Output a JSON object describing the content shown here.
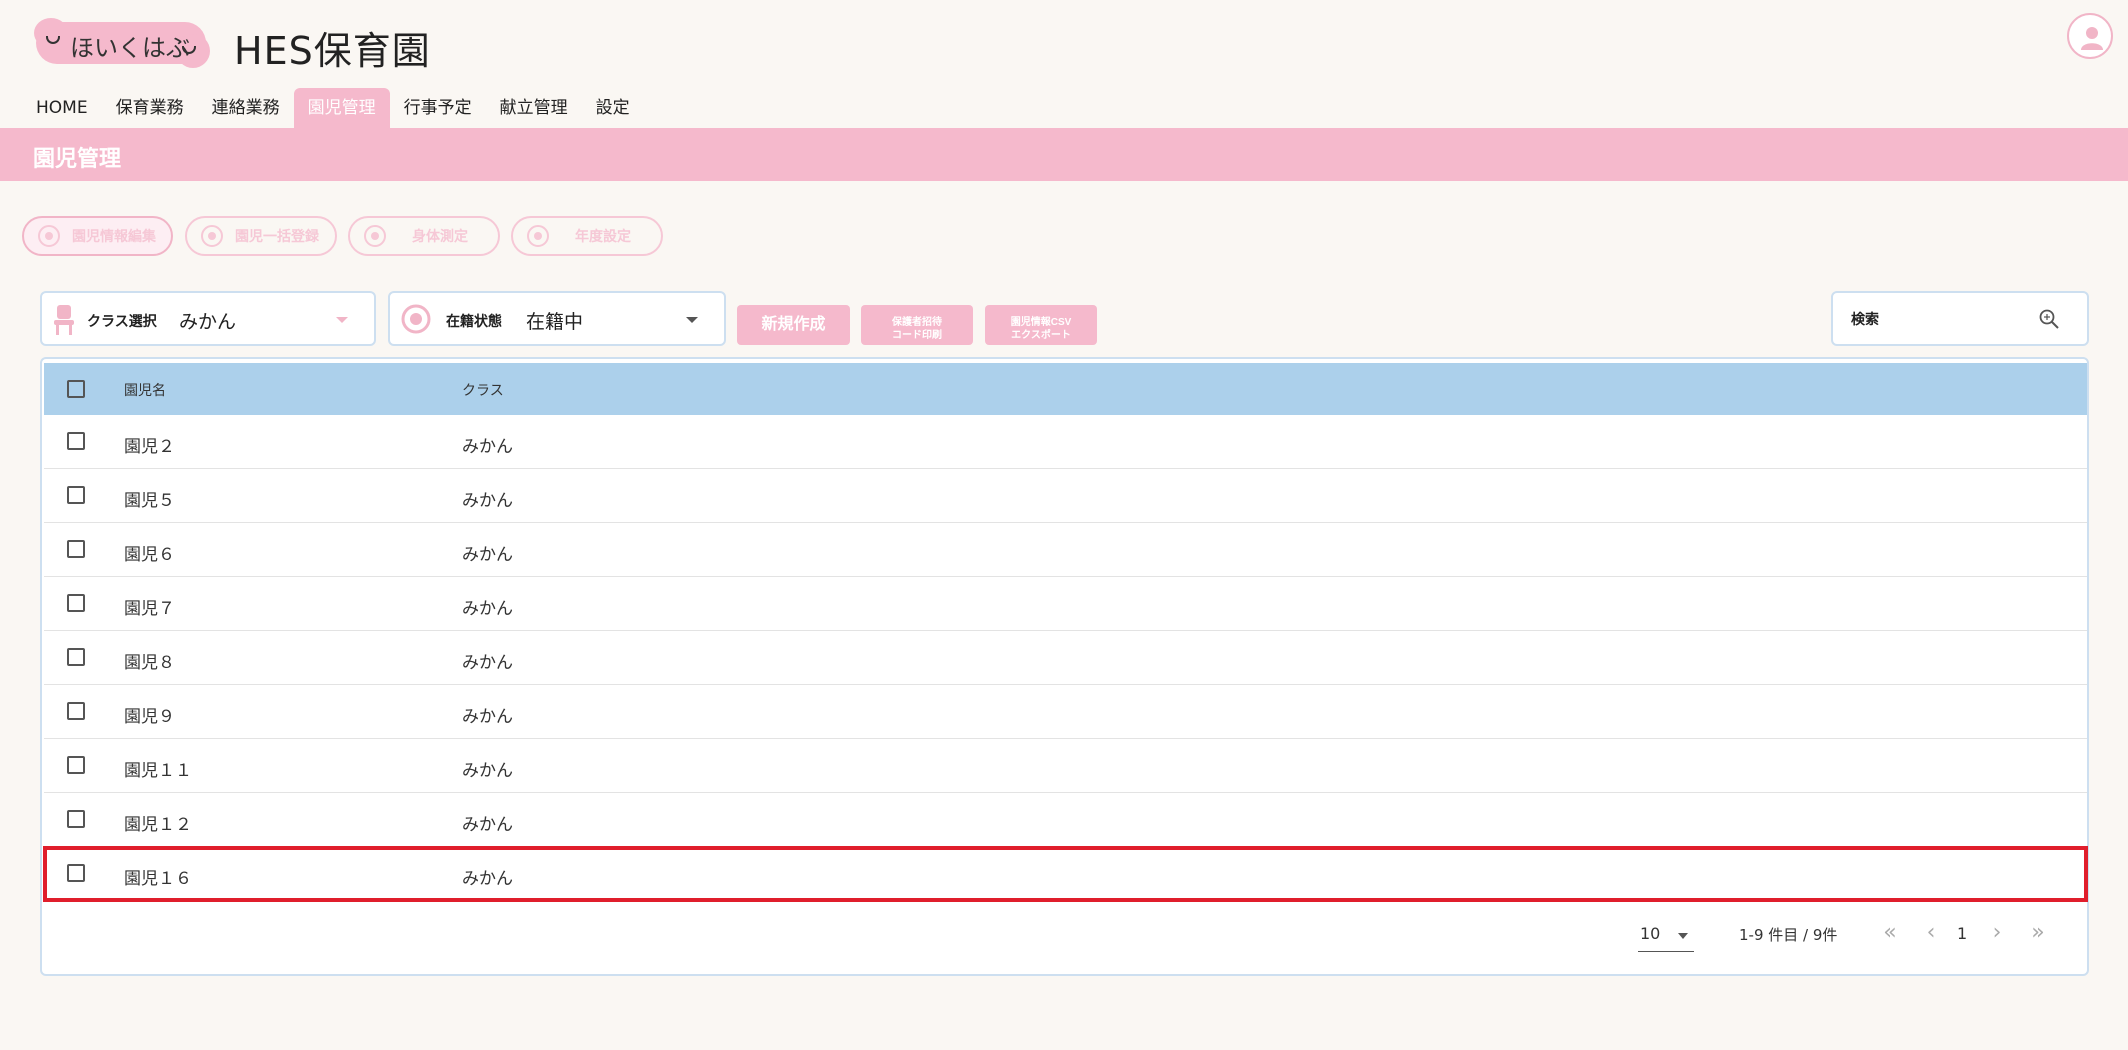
{
  "header": {
    "logo_text": "ほいくはぶ",
    "site_title": "HES保育園"
  },
  "nav": {
    "items": [
      {
        "label": "HOME",
        "active": false
      },
      {
        "label": "保育業務",
        "active": false
      },
      {
        "label": "連絡業務",
        "active": false
      },
      {
        "label": "園児管理",
        "active": true
      },
      {
        "label": "行事予定",
        "active": false
      },
      {
        "label": "献立管理",
        "active": false
      },
      {
        "label": "設定",
        "active": false
      }
    ]
  },
  "page": {
    "title": "園児管理"
  },
  "actions": {
    "items": [
      "園児情報編集",
      "園児一括登録",
      "身体測定",
      "年度設定"
    ]
  },
  "filters": {
    "class_label": "クラス選択",
    "class_value": "みかん",
    "status_label": "在籍状態",
    "status_value": "在籍中"
  },
  "buttons": {
    "create": "新規作成",
    "guardian_code_line1": "保護者招待",
    "guardian_code_line2": "コード印刷",
    "csv_line1": "園児情報CSV",
    "csv_line2": "エクスポート"
  },
  "search": {
    "placeholder": "検索"
  },
  "table": {
    "headers": [
      "園児名",
      "クラス"
    ],
    "rows": [
      {
        "name": "園児２",
        "class": "みかん"
      },
      {
        "name": "園児５",
        "class": "みかん"
      },
      {
        "name": "園児６",
        "class": "みかん"
      },
      {
        "name": "園児７",
        "class": "みかん"
      },
      {
        "name": "園児８",
        "class": "みかん"
      },
      {
        "name": "園児９",
        "class": "みかん"
      },
      {
        "name": "園児１１",
        "class": "みかん"
      },
      {
        "name": "園児１２",
        "class": "みかん"
      },
      {
        "name": "園児１６",
        "class": "みかん"
      }
    ]
  },
  "pagination": {
    "page_size": "10",
    "info": "1-9 件目 / 9件",
    "current_page": "1",
    "first": "«",
    "prev": "‹",
    "next": "›",
    "last": "»"
  },
  "colors": {
    "accent_pink": "#f5b9cc",
    "header_blue": "#acd0eb",
    "highlight_red": "#e01e2c"
  }
}
